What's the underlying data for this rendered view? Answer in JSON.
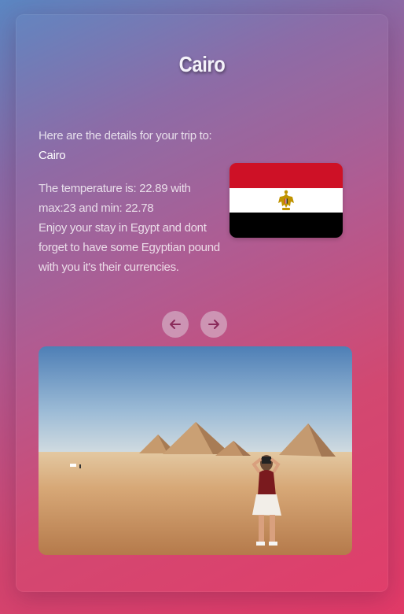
{
  "page": {
    "title": "Cairo"
  },
  "trip": {
    "intro": "Here are the details for your trip to:",
    "city": "Cairo",
    "temperature_line": "The temperature is: 22.89 with max:23 and min: 22.78",
    "advice_line": "Enjoy your stay in Egypt and dont forget to have some Egyptian pound with you it's their currencies."
  },
  "flag": {
    "country": "Egypt",
    "colors": [
      "#ce1126",
      "#ffffff",
      "#000000"
    ],
    "emblem_color": "#c09300"
  },
  "navigation": {
    "prev_icon": "arrow-left-icon",
    "next_icon": "arrow-right-icon"
  },
  "photo": {
    "subject": "Pyramids of Giza with tourist taking photo"
  },
  "colors": {
    "gradient_start": "#5b86c2",
    "gradient_end": "#e23a68",
    "nav_button": "#dcc8d7"
  }
}
